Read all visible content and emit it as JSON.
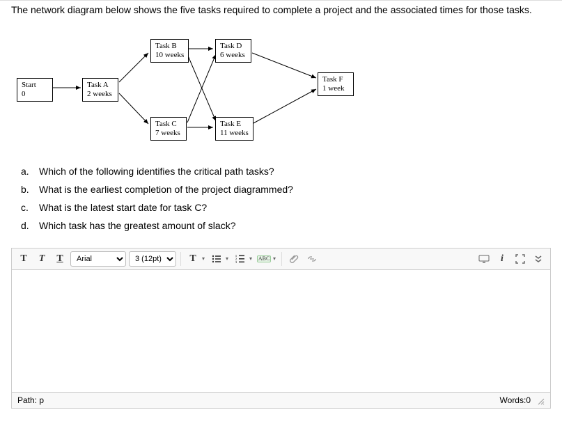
{
  "intro": "The network diagram below shows the five tasks required to complete a project and the associated times for those tasks.",
  "nodes": {
    "start": {
      "name": "Start",
      "time": "0"
    },
    "a": {
      "name": "Task A",
      "time": "2 weeks"
    },
    "b": {
      "name": "Task B",
      "time": "10 weeks"
    },
    "c": {
      "name": "Task C",
      "time": "7 weeks"
    },
    "d": {
      "name": "Task D",
      "time": "6 weeks"
    },
    "e": {
      "name": "Task E",
      "time": "11 weeks"
    },
    "f": {
      "name": "Task F",
      "time": "1 week"
    }
  },
  "questions": {
    "a": {
      "letter": "a.",
      "text": "Which of the following identifies the critical path tasks?"
    },
    "b": {
      "letter": "b.",
      "text": "What is the earliest completion of the project diagrammed?"
    },
    "c": {
      "letter": "c.",
      "text": "What is the latest start date for task C?"
    },
    "d": {
      "letter": "d.",
      "text": "Which task has the greatest amount of slack?"
    }
  },
  "toolbar": {
    "bold": "T",
    "italic": "T",
    "underline": "T",
    "font": "Arial",
    "size": "3 (12pt)",
    "textT": "T",
    "abc": "ABC"
  },
  "status": {
    "path_label": "Path: p",
    "words_label": "Words:0"
  }
}
